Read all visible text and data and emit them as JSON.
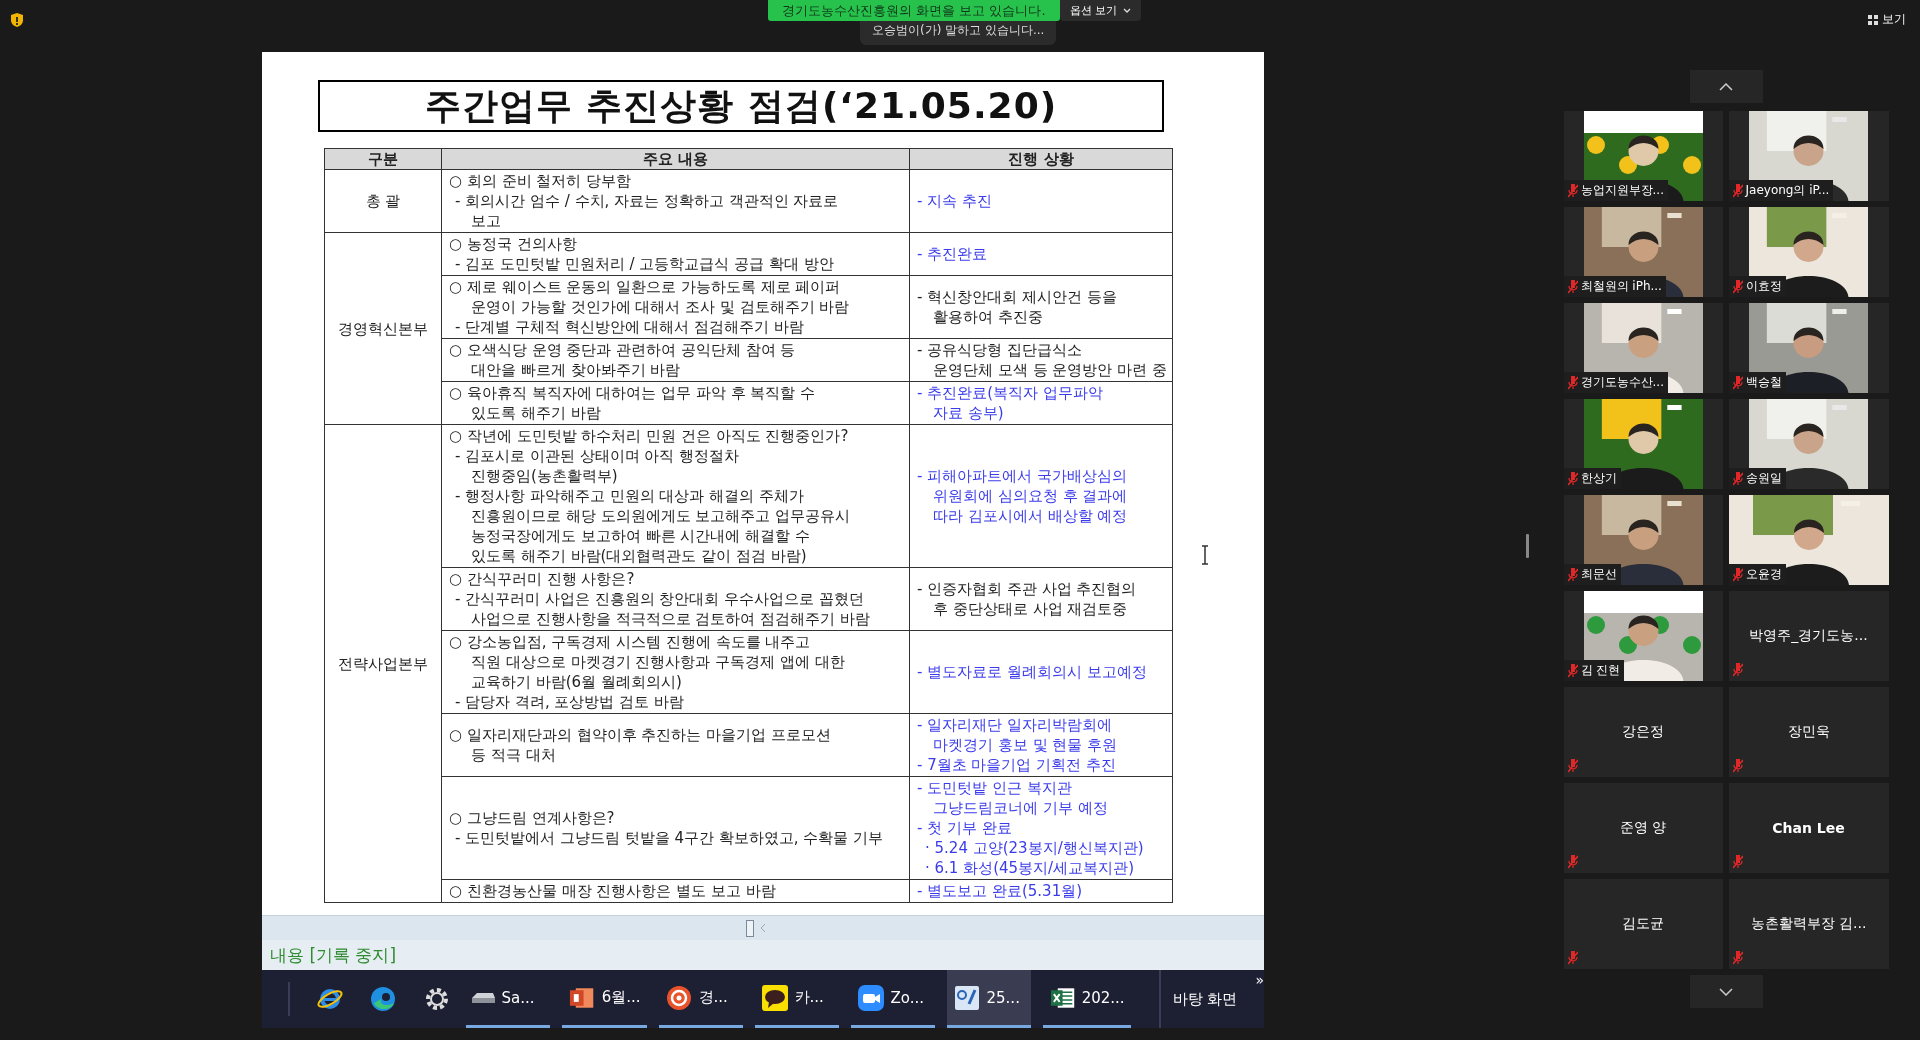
{
  "top_bar": {
    "sharing_banner": "경기도농수산진흥원의 화면을 보고 있습니다.",
    "speaker_notice": "오승범이(가) 말하고 있습니다...",
    "options_button": "옵션 보기",
    "view_button": "보기"
  },
  "document": {
    "title": "주간업무 추진상황 점검(‘21.05.20)",
    "columns": [
      "구분",
      "주요 내용",
      "진행 상황"
    ],
    "sections": [
      {
        "category": "총 괄",
        "rows": [
          {
            "content": [
              {
                "kind": "bullet",
                "text": "○ 회의 준비 철저히 당부함"
              },
              {
                "kind": "dash",
                "text": "- 회의시간 엄수 / 수치, 자료는 정확하고 객관적인 자료로"
              },
              {
                "kind": "cont",
                "text": "보고"
              }
            ],
            "color": "#3b3bea",
            "status": [
              {
                "kind": "dash",
                "text": "- 지속 추진"
              }
            ]
          }
        ]
      },
      {
        "category": "경영혁신본부",
        "rows": [
          {
            "content": [
              {
                "kind": "bullet",
                "text": "○ 농정국 건의사항"
              },
              {
                "kind": "dash",
                "text": "- 김포 도민텃밭 민원처리 / 고등학교급식 공급 확대 방안"
              }
            ],
            "color": "#3b3bea",
            "status": [
              {
                "kind": "dash",
                "text": "- 추진완료"
              }
            ]
          },
          {
            "content": [
              {
                "kind": "bullet",
                "text": "○ 제로 웨이스트 운동의 일환으로 가능하도록 제로 페이퍼"
              },
              {
                "kind": "cont",
                "text": "운영이 가능할 것인가에 대해서 조사 및 검토해주기 바람"
              },
              {
                "kind": "dash",
                "text": "- 단계별 구체적 혁신방안에 대해서 점검해주기 바람"
              }
            ],
            "color": "#222222",
            "status": [
              {
                "kind": "dash",
                "text": "- 혁신창안대회 제시안건 등을"
              },
              {
                "kind": "cont",
                "text": "활용하여 추진중"
              }
            ]
          },
          {
            "content": [
              {
                "kind": "bullet",
                "text": "○ 오색식당 운영 중단과 관련하여 공익단체 참여 등"
              },
              {
                "kind": "cont",
                "text": "대안을 빠르게 찾아봐주기 바람"
              }
            ],
            "color": "#222222",
            "status": [
              {
                "kind": "dash",
                "text": "- 공유식당형 집단급식소"
              },
              {
                "kind": "cont",
                "text": "운영단체 모색 등 운영방안 마련 중"
              }
            ]
          },
          {
            "content": [
              {
                "kind": "bullet",
                "text": "○ 육아휴직 복직자에 대하여는 업무 파악 후 복직할 수"
              },
              {
                "kind": "cont",
                "text": "있도록 해주기 바람"
              }
            ],
            "color": "#3b3bea",
            "status": [
              {
                "kind": "dash",
                "text": "- 추진완료(복직자 업무파악"
              },
              {
                "kind": "cont",
                "text": "자료 송부)"
              }
            ]
          }
        ]
      },
      {
        "category": "전략사업본부",
        "rows": [
          {
            "content": [
              {
                "kind": "bullet",
                "text": "○ 작년에 도민텃밭 하수처리 민원 건은 아직도 진행중인가?"
              },
              {
                "kind": "dash",
                "text": "- 김포시로 이관된 상태이며 아직 행정절차"
              },
              {
                "kind": "cont",
                "text": "진행중임(농촌활력부)"
              },
              {
                "kind": "dash",
                "text": "- 행정사항 파악해주고 민원의 대상과 해결의 주체가"
              },
              {
                "kind": "cont",
                "text": "진흥원이므로 해당 도의원에게도 보고해주고 업무공유시"
              },
              {
                "kind": "cont",
                "text": "농정국장에게도 보고하여 빠른 시간내에 해결할 수"
              },
              {
                "kind": "cont",
                "text": "있도록 해주기 바람(대외협력관도 같이 점검 바람)"
              }
            ],
            "color": "#3b3bea",
            "status": [
              {
                "kind": "dash",
                "text": "- 피해아파트에서 국가배상심의"
              },
              {
                "kind": "cont",
                "text": "위원회에 심의요청 후 결과에"
              },
              {
                "kind": "cont",
                "text": "따라 김포시에서 배상할 예정"
              }
            ]
          },
          {
            "content": [
              {
                "kind": "bullet",
                "text": "○ 간식꾸러미 진행 사항은?"
              },
              {
                "kind": "dash",
                "text": "- 간식꾸러미 사업은 진흥원의 창안대회 우수사업으로 꼽혔던"
              },
              {
                "kind": "cont",
                "text": "사업으로 진행사항을 적극적으로 검토하여 점검해주기 바람"
              }
            ],
            "color": "#222222",
            "status": [
              {
                "kind": "dash",
                "text": "- 인증자협회 주관 사업 추진협의"
              },
              {
                "kind": "cont",
                "text": "후 중단상태로 사업 재검토중"
              }
            ]
          },
          {
            "content": [
              {
                "kind": "bullet",
                "text": "○ 강소농입점, 구독경제 시스템 진행에 속도를 내주고"
              },
              {
                "kind": "cont",
                "text": "직원 대상으로 마켓경기 진행사항과 구독경제 앱에 대한"
              },
              {
                "kind": "cont",
                "text": "교육하기 바람(6월 월례회의시)"
              },
              {
                "kind": "dash",
                "text": "- 담당자 격려, 포상방법 검토 바람"
              }
            ],
            "color": "#3b3bea",
            "status": [
              {
                "kind": "dash",
                "text": "- 별도자료로 월례회의시 보고예정"
              }
            ]
          },
          {
            "content": [
              {
                "kind": "bullet",
                "text": "○ 일자리재단과의 협약이후 추진하는 마을기업 프로모션"
              },
              {
                "kind": "cont",
                "text": "등 적극 대처"
              }
            ],
            "color": "#3b3bea",
            "status": [
              {
                "kind": "dash",
                "text": "- 일자리재단 일자리박람회에"
              },
              {
                "kind": "cont",
                "text": "마켓경기 홍보 및 현물 후원"
              },
              {
                "kind": "dash",
                "text": "- 7월초 마을기업 기획전 추진"
              }
            ]
          },
          {
            "content": [
              {
                "kind": "bullet",
                "text": "○ 그냥드림 연계사항은?"
              },
              {
                "kind": "dash",
                "text": "- 도민텃밭에서 그냥드림 텃밭을 4구간 확보하였고, 수확물 기부"
              }
            ],
            "color": "#3b3bea",
            "status": [
              {
                "kind": "dash",
                "text": "- 도민텃밭 인근 복지관"
              },
              {
                "kind": "cont",
                "text": "그냥드림코너에 기부 예정"
              },
              {
                "kind": "dash",
                "text": "- 첫 기부 완료"
              },
              {
                "kind": "dot",
                "text": "· 5.24 고양(23봉지/행신복지관)"
              },
              {
                "kind": "dot",
                "text": "· 6.1 화성(45봉지/세교복지관)"
              }
            ]
          },
          {
            "content": [
              {
                "kind": "bullet",
                "text": "○ 친환경농산물 매장 진행사항은 별도 보고 바람"
              }
            ],
            "color": "#3b3bea",
            "status": [
              {
                "kind": "dash",
                "text": "- 별도보고 완료(5.31월)"
              }
            ]
          }
        ]
      }
    ]
  },
  "screen_status": "내용 [기록 중지]",
  "taskbar": {
    "items": [
      {
        "kind": "icon"
      },
      {
        "kind": "icon"
      },
      {
        "kind": "icon"
      },
      {
        "kind": "app",
        "label": "Sa...",
        "selected": false
      },
      {
        "kind": "app",
        "label": "6월...",
        "selected": false
      },
      {
        "kind": "app",
        "label": "경...",
        "selected": false
      },
      {
        "kind": "app",
        "label": "카...",
        "selected": false
      },
      {
        "kind": "app",
        "label": "Zo...",
        "selected": false
      },
      {
        "kind": "app",
        "label": "25...",
        "selected": true
      },
      {
        "kind": "app",
        "label": "202...",
        "selected": false
      }
    ],
    "desktop_button": "바탕 화면",
    "overflow": "»"
  },
  "gallery": {
    "participants": [
      {
        "name": "농업지원부장...",
        "kind": "video",
        "muted": true
      },
      {
        "name": "Jaeyong의 iP...",
        "kind": "video",
        "muted": true
      },
      {
        "name": "최철원의 iPh...",
        "kind": "video",
        "muted": true
      },
      {
        "name": "이효정",
        "kind": "video",
        "muted": true
      },
      {
        "name": "경기도농수산...",
        "kind": "video",
        "muted": true
      },
      {
        "name": "백승철",
        "kind": "video",
        "muted": true
      },
      {
        "name": "한상기",
        "kind": "video",
        "muted": true
      },
      {
        "name": "송원일",
        "kind": "video",
        "muted": true
      },
      {
        "name": "최문선",
        "kind": "video",
        "muted": true
      },
      {
        "name": "오윤경",
        "kind": "video_wide",
        "muted": true
      },
      {
        "name": "김 진현",
        "kind": "video",
        "muted": true
      },
      {
        "name": "박영주_경기도농...",
        "kind": "name",
        "muted": true,
        "bold": false
      },
      {
        "name": "강은정",
        "kind": "name",
        "muted": true,
        "bold": false
      },
      {
        "name": "장민욱",
        "kind": "name",
        "muted": true,
        "bold": false
      },
      {
        "name": "준영 양",
        "kind": "name",
        "muted": true,
        "bold": false
      },
      {
        "name": "Chan Lee",
        "kind": "name",
        "muted": true,
        "bold": true
      },
      {
        "name": "김도균",
        "kind": "name",
        "muted": true,
        "bold": false
      },
      {
        "name": "농촌활력부장 김...",
        "kind": "name",
        "muted": true,
        "bold": false
      }
    ]
  }
}
